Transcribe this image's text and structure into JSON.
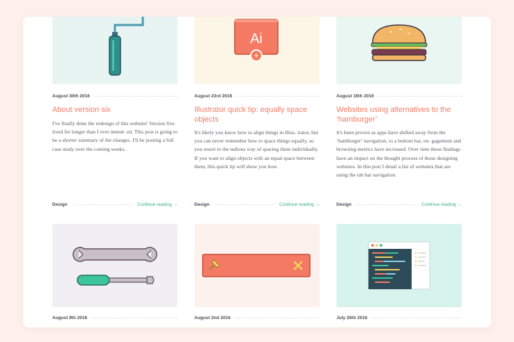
{
  "posts": [
    {
      "date": "August 30th 2016",
      "title": "About version six",
      "excerpt": "I've finally done the redesign of this website! Version five lived for longer than I ever intend- ed. This post is going to be a shorter summary of the changes. I'll be posting a full case study over the coming weeks.",
      "category": "Design",
      "read_more": "Continue reading →",
      "thumb_icon": "paint-roller-icon",
      "thumb_bg": "#e8f4f2"
    },
    {
      "date": "August 23rd 2016",
      "title": "Illustrator quick tip: equally space objects",
      "excerpt": "It's likely you know how to align things in Illus- trator, but you can never remember how to space things equally, so you resort to the tedious way of spacing them individually. If you want to align objects with an equal space between them, this quick tip will show you how.",
      "category": "Design",
      "read_more": "Continue reading →",
      "thumb_icon": "illustrator-icon",
      "icon_text": "Ai",
      "thumb_bg": "#fdf6e6"
    },
    {
      "date": "August 16th 2016",
      "title": "Websites using alternatives to the ‘hamburger’",
      "excerpt": "It's been proven as apps have shifted away from the ‘hamburger’ navigation, to a bottom bar, en- gagement and browsing metrics have increased. Over time these findings have an impact on the thought process of those designing websites. In this post I detail a list of websites that are using the tab bar navigation.",
      "category": "Design",
      "read_more": "Continue reading →",
      "thumb_icon": "hamburger-icon",
      "thumb_bg": "#eaf6f2"
    },
    {
      "date": "August 9th 2016",
      "thumb_icon": "wrench-screwdriver-icon",
      "thumb_bg": "#f1eff3"
    },
    {
      "date": "August 2nd 2016",
      "thumb_icon": "pinned-bar-icon",
      "thumb_bg": "#fdf1ee"
    },
    {
      "date": "July 26th 2016",
      "thumb_icon": "code-editor-icon",
      "thumb_bg": "#d6f3ec"
    }
  ],
  "colors": {
    "page_bg": "#fdf0ec",
    "accent_title": "#f47a63",
    "accent_link": "#2fae86"
  }
}
